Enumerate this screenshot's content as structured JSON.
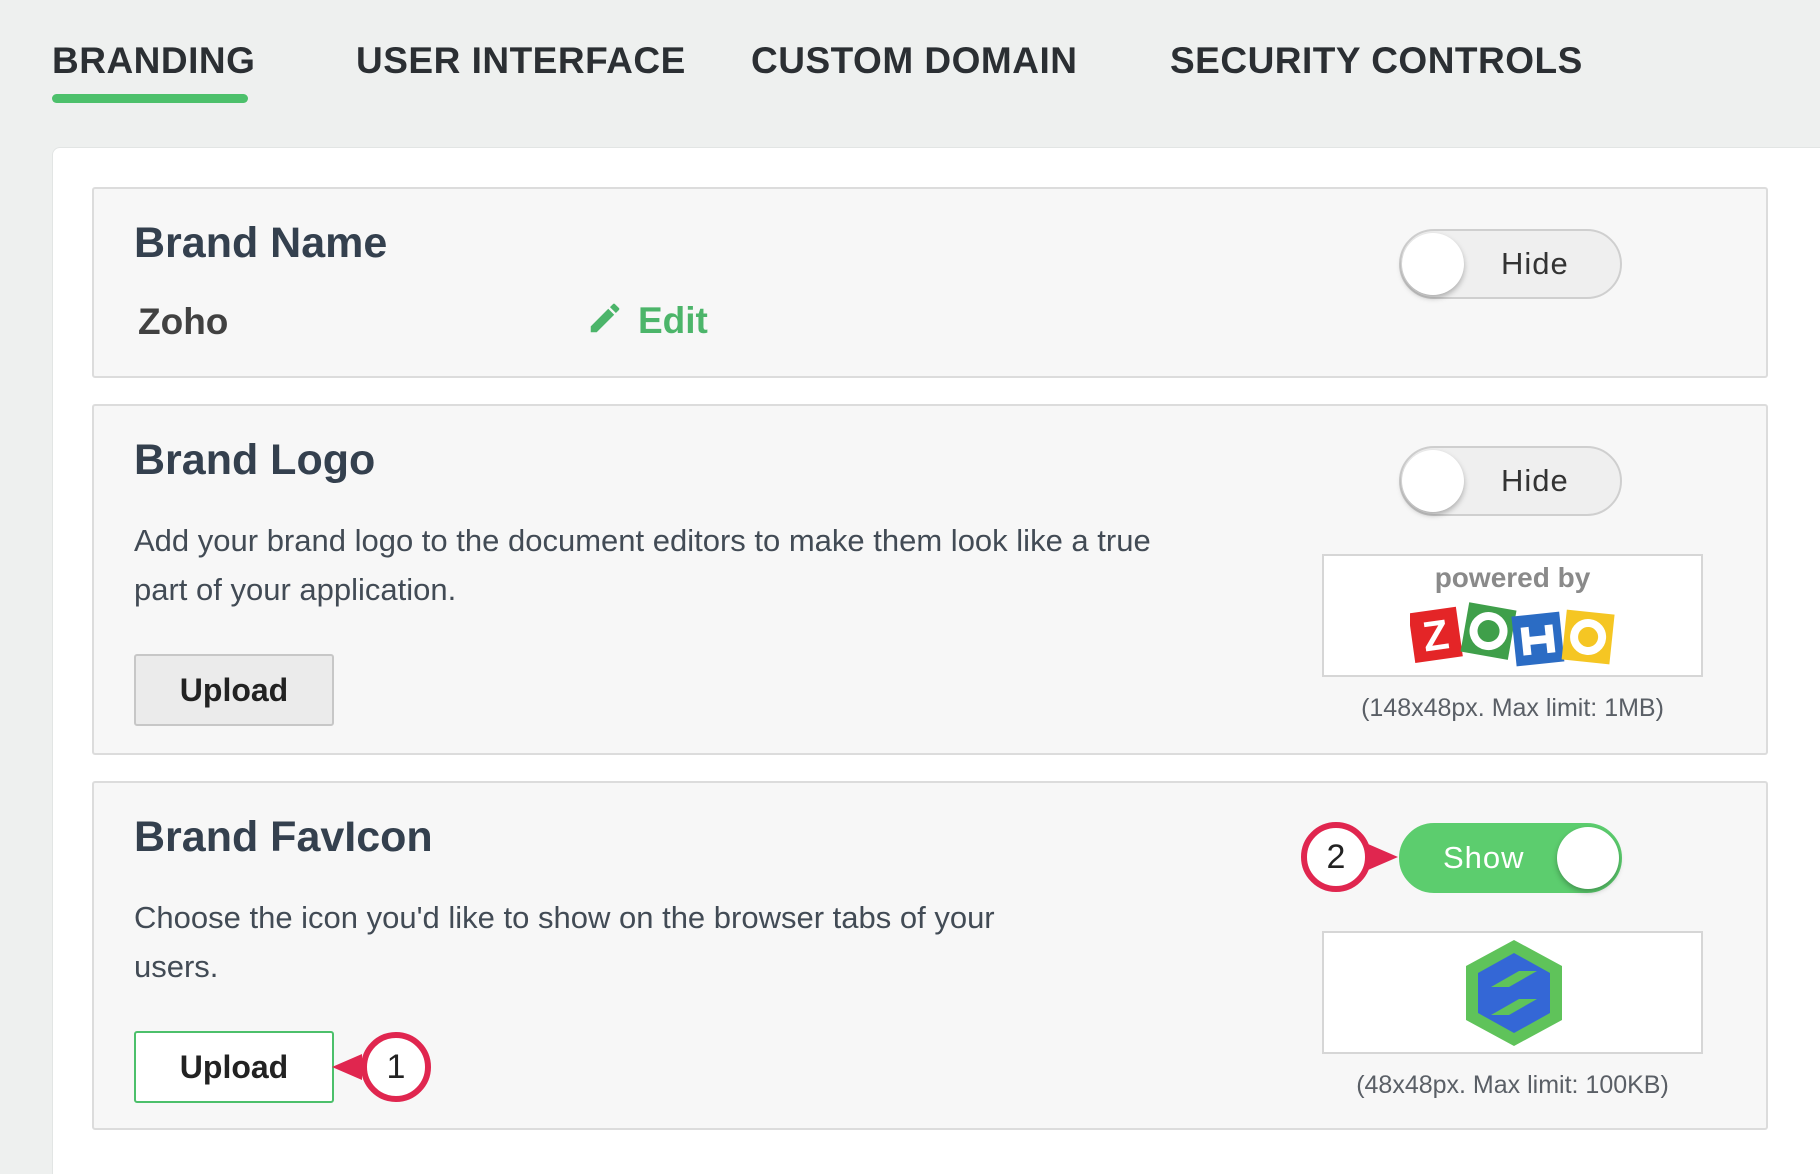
{
  "tabs": [
    {
      "label": "BRANDING",
      "active": true
    },
    {
      "label": "USER INTERFACE",
      "active": false
    },
    {
      "label": "CUSTOM DOMAIN",
      "active": false
    },
    {
      "label": "SECURITY CONTROLS",
      "active": false
    }
  ],
  "brand_name": {
    "title": "Brand Name",
    "value": "Zoho",
    "edit_label": "Edit",
    "toggle_label": "Hide",
    "toggle_on": false
  },
  "brand_logo": {
    "title": "Brand Logo",
    "description": "Add your brand logo to the document editors to make them look like a true part of your application.",
    "upload_label": "Upload",
    "toggle_label": "Hide",
    "toggle_on": false,
    "preview_powered_text": "powered by",
    "preview_logo_text": "ZOHO",
    "caption": "(148x48px. Max limit: 1MB)"
  },
  "brand_favicon": {
    "title": "Brand FavIcon",
    "description": "Choose the icon you'd like to show on the browser tabs of your users.",
    "upload_label": "Upload",
    "toggle_label": "Show",
    "toggle_on": true,
    "caption": "(48x48px. Max limit: 100KB)"
  },
  "markers": {
    "upload_marker": "1",
    "toggle_marker": "2"
  },
  "colors": {
    "accent_green": "#4cc06b",
    "marker_red": "#e0264f"
  },
  "icons": {
    "edit": "pencil-icon",
    "favicon": "hexagon-logo-icon"
  }
}
